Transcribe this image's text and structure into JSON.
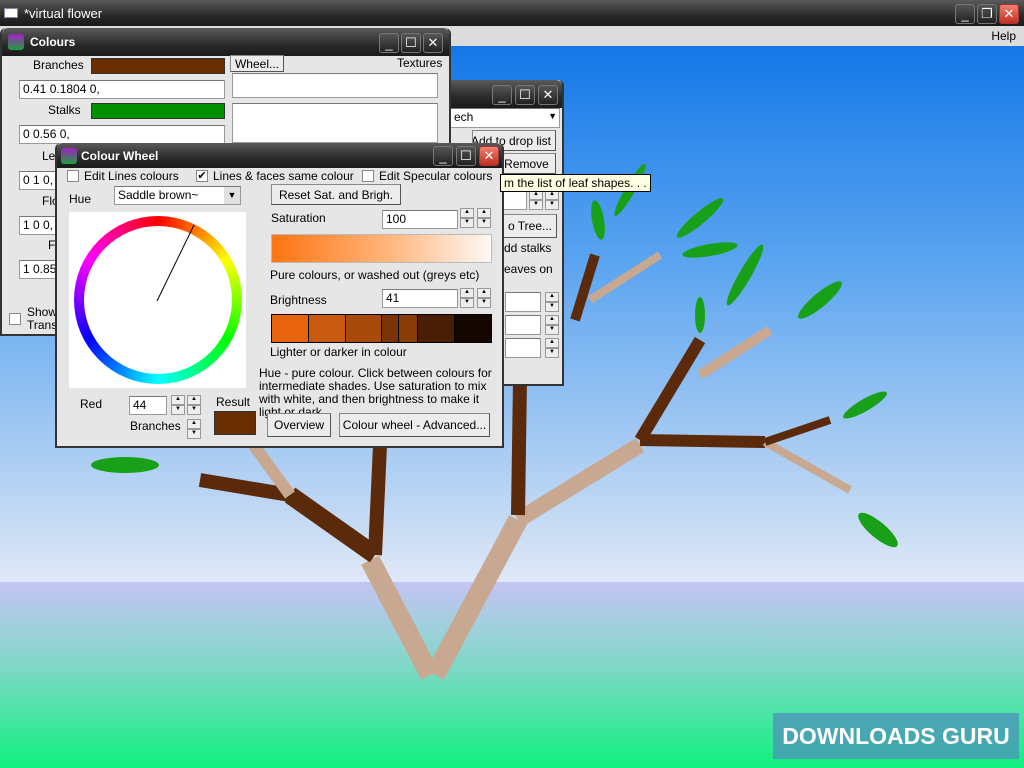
{
  "app": {
    "title": "*virtual flower",
    "menu_help": "Help"
  },
  "colours": {
    "title": "Colours",
    "branches_label": "Branches",
    "branches_value": "0.41 0.1804 0,",
    "branches_color": "#692e00",
    "stalks_label": "Stalks",
    "stalks_value": "0 0.56 0,",
    "stalks_color": "#008f00",
    "leaves_label": "Le",
    "leaves_value": "0 1 0,",
    "flowers_label": "Flo",
    "flowers_value": "1 0 0,",
    "fruit_label": "F",
    "fruit_value": "1 0.85",
    "wheel_button": "Wheel...",
    "textures_label": "Textures",
    "show_label": "Show",
    "trans_label": "Trans"
  },
  "leafwin": {
    "dropdown_value": "ech",
    "add_button": "Add to drop list",
    "remove_button": "Remove",
    "tooltip": "m the list of leaf shapes. . .",
    "tree_button": "o Tree...",
    "add_stalks": "dd stalks",
    "leaves_on": "eaves on"
  },
  "wheel": {
    "title": "Colour Wheel",
    "edit_lines": "Edit Lines colours",
    "edit_lines_checked": false,
    "same_colour": "Lines & faces same colour",
    "same_colour_checked": true,
    "edit_specular": "Edit Specular colours",
    "edit_specular_checked": false,
    "hue_label": "Hue",
    "hue_value": "Saddle brown~",
    "reset_button": "Reset Sat. and Brigh.",
    "saturation_label": "Saturation",
    "saturation_value": "100",
    "saturation_hint": "Pure colours, or washed out (greys etc)",
    "brightness_label": "Brightness",
    "brightness_value": "41",
    "brightness_hint": "Lighter or darker in colour",
    "help_text": "Hue - pure colour. Click between colours for intermediate shades. Use saturation to mix with white, and then brightness to make it light or dark",
    "red_label": "Red",
    "red_value": "44",
    "branches_label": "Branches",
    "result_label": "Result",
    "result_color": "#692e00",
    "overview_button": "Overview",
    "advanced_button": "Colour wheel - Advanced...",
    "brightness_swatches": [
      "#e8640c",
      "#c85a10",
      "#a84a0c",
      "#7a3408",
      "#8a3c08",
      "#4a1e04",
      "#140600"
    ]
  },
  "watermark": "DOWNLOADS GURU"
}
